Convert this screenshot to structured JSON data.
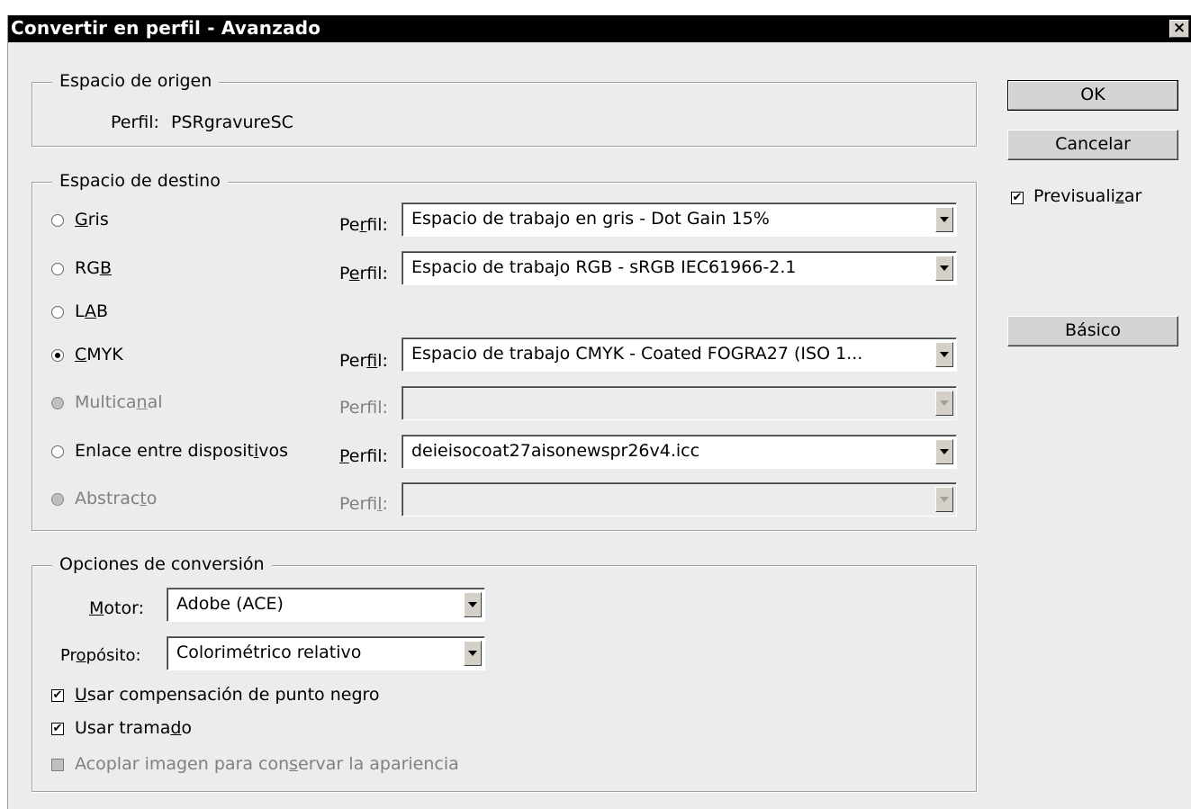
{
  "window": {
    "title": "Convertir en perfil - Avanzado",
    "close": "×"
  },
  "source": {
    "legend": "Espacio de origen",
    "profile_label": "Perfil:",
    "profile_value": "PSRgravureSC"
  },
  "destination": {
    "legend": "Espacio de destino",
    "rows": [
      {
        "label": "Gris",
        "selected": false,
        "enabled": true,
        "profile_label": "Perfil:",
        "profile_value": "Espacio de trabajo en gris - Dot Gain 15%",
        "has_profile": true
      },
      {
        "label": "RGB",
        "selected": false,
        "enabled": true,
        "profile_label": "Perfil:",
        "profile_value": "Espacio de trabajo RGB - sRGB IEC61966-2.1",
        "has_profile": true
      },
      {
        "label": "LAB",
        "selected": false,
        "enabled": true,
        "has_profile": false
      },
      {
        "label": "CMYK",
        "selected": true,
        "enabled": true,
        "profile_label": "Perfil:",
        "profile_value": "Espacio de trabajo CMYK - Coated FOGRA27 (ISO 1...",
        "has_profile": true
      },
      {
        "label": "Multicanal",
        "selected": false,
        "enabled": false,
        "profile_label": "Perfil:",
        "profile_value": "",
        "has_profile": true
      },
      {
        "label": "Enlace entre dispositivos",
        "selected": false,
        "enabled": true,
        "profile_label": "Perfil:",
        "profile_value": "deieisocoat27aisonewspr26v4.icc",
        "has_profile": true
      },
      {
        "label": "Abstracto",
        "selected": false,
        "enabled": false,
        "profile_label": "Perfil:",
        "profile_value": "",
        "has_profile": true
      }
    ]
  },
  "conversion": {
    "legend": "Opciones de conversión",
    "engine_label": "Motor:",
    "engine_value": "Adobe (ACE)",
    "intent_label": "Propósito:",
    "intent_value": "Colorimétrico relativo",
    "black_point": {
      "label": "Usar compensación de punto negro",
      "checked": true,
      "enabled": true
    },
    "dither": {
      "label": "Usar tramado",
      "checked": true,
      "enabled": true
    },
    "flatten": {
      "label": "Acoplar imagen para conservar la apariencia",
      "checked": false,
      "enabled": false
    }
  },
  "buttons": {
    "ok": "OK",
    "cancel": "Cancelar",
    "basic": "Básico"
  },
  "preview": {
    "label": "Previsualizar",
    "checked": true
  },
  "icons": {
    "check": "✔",
    "dropdown": "chevron-down-icon",
    "radio": "radio-icon"
  }
}
